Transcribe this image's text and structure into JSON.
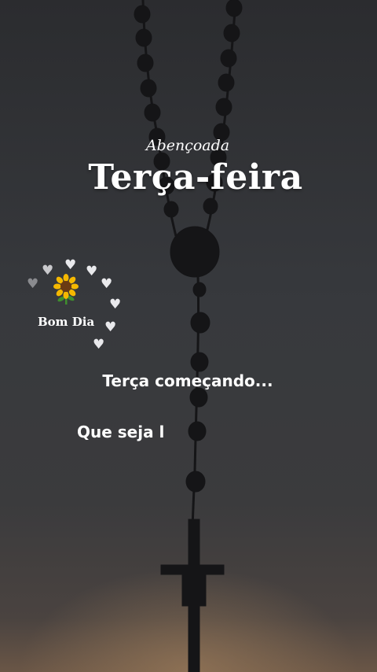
{
  "header": {
    "subtitle": "Abençoada",
    "title": "Terça-feira"
  },
  "badge": {
    "label": "Bom Dia",
    "icons": [
      "heart-icon",
      "sunflower-icon"
    ]
  },
  "message": {
    "line1": "Terça começando...",
    "line2": "Que seja l"
  },
  "colors": {
    "text": "#ffffff",
    "sky_top": "#2a2b2e",
    "sky_bottom": "#5a4a3e",
    "silhouette": "#141416"
  }
}
